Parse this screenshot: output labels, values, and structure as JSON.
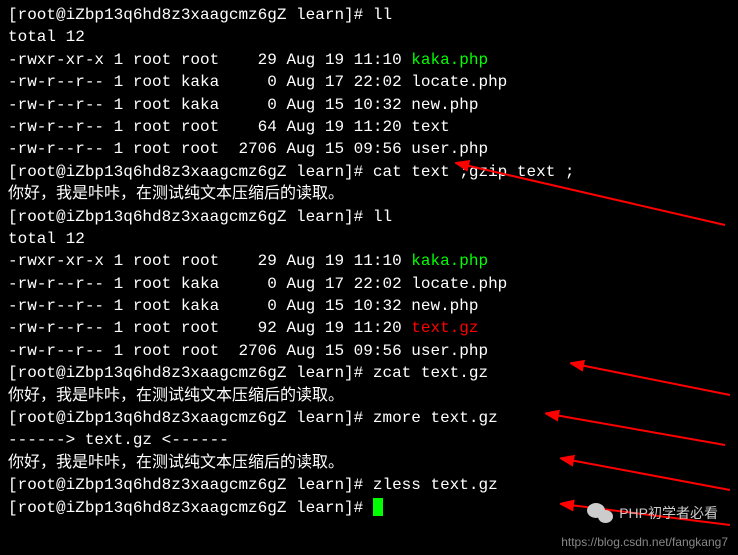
{
  "prompt": "[root@iZbp13q6hd8z3xaagcmz6gZ learn]# ",
  "commands": {
    "ll": "ll",
    "cat_gzip": "cat text ;gzip text ;",
    "zcat": "zcat text.gz",
    "zmore": "zmore text.gz",
    "zless": "zless text.gz"
  },
  "total": "total 12",
  "listing1": [
    {
      "perms": "-rwxr-xr-x",
      "links": "1",
      "owner": "root",
      "group": "root",
      "size": "   29",
      "date": "Aug 19 11:10",
      "name": "kaka.php",
      "color": "green"
    },
    {
      "perms": "-rw-r--r--",
      "links": "1",
      "owner": "root",
      "group": "kaka",
      "size": "    0",
      "date": "Aug 17 22:02",
      "name": "locate.php",
      "color": ""
    },
    {
      "perms": "-rw-r--r--",
      "links": "1",
      "owner": "root",
      "group": "kaka",
      "size": "    0",
      "date": "Aug 15 10:32",
      "name": "new.php",
      "color": ""
    },
    {
      "perms": "-rw-r--r--",
      "links": "1",
      "owner": "root",
      "group": "root",
      "size": "   64",
      "date": "Aug 19 11:20",
      "name": "text",
      "color": ""
    },
    {
      "perms": "-rw-r--r--",
      "links": "1",
      "owner": "root",
      "group": "root",
      "size": " 2706",
      "date": "Aug 15 09:56",
      "name": "user.php",
      "color": ""
    }
  ],
  "chinese_text": "你好，我是咔咔，在测试纯文本压缩后的读取。",
  "listing2": [
    {
      "perms": "-rwxr-xr-x",
      "links": "1",
      "owner": "root",
      "group": "root",
      "size": "   29",
      "date": "Aug 19 11:10",
      "name": "kaka.php",
      "color": "green"
    },
    {
      "perms": "-rw-r--r--",
      "links": "1",
      "owner": "root",
      "group": "kaka",
      "size": "    0",
      "date": "Aug 17 22:02",
      "name": "locate.php",
      "color": ""
    },
    {
      "perms": "-rw-r--r--",
      "links": "1",
      "owner": "root",
      "group": "kaka",
      "size": "    0",
      "date": "Aug 15 10:32",
      "name": "new.php",
      "color": ""
    },
    {
      "perms": "-rw-r--r--",
      "links": "1",
      "owner": "root",
      "group": "root",
      "size": "   92",
      "date": "Aug 19 11:20",
      "name": "text.gz",
      "color": "red"
    },
    {
      "perms": "-rw-r--r--",
      "links": "1",
      "owner": "root",
      "group": "root",
      "size": " 2706",
      "date": "Aug 15 09:56",
      "name": "user.php",
      "color": ""
    }
  ],
  "zmore_header": "------> text.gz <------",
  "watermark": "PHP初学者必看",
  "blog_url": "https://blog.csdn.net/fangkang7"
}
